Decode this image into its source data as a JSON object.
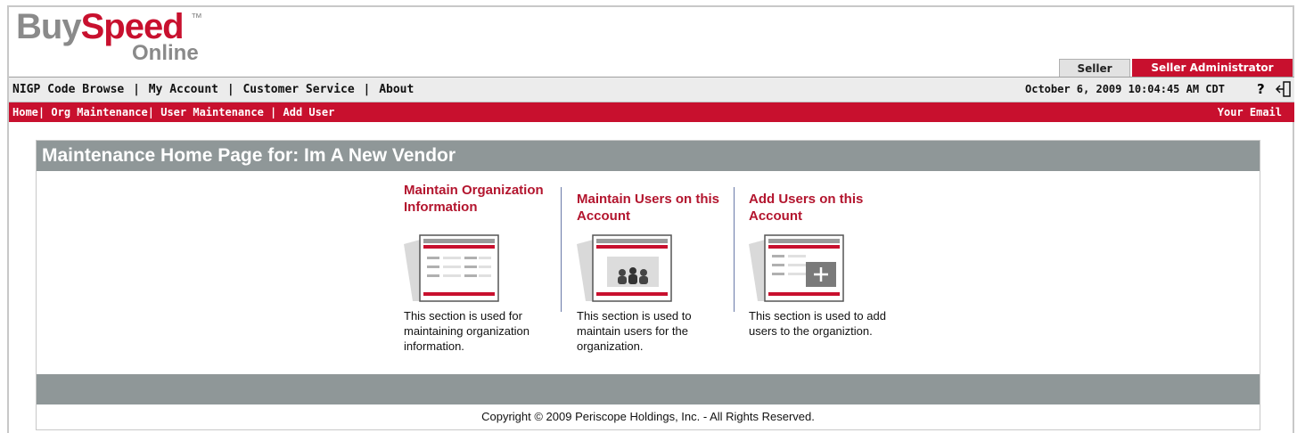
{
  "logo": {
    "part1": "Buy",
    "part2": "Speed",
    "tm": "™",
    "online": "Online"
  },
  "role_tabs": {
    "seller": "Seller",
    "seller_admin": "Seller Administrator"
  },
  "top_nav": {
    "items": [
      "NIGP Code Browse",
      "My Account",
      "Customer Service",
      "About"
    ],
    "separator": "|",
    "datetime": "October 6, 2009 10:04:45 AM CDT",
    "help": "?"
  },
  "sub_nav": {
    "items": [
      "Home",
      "Org Maintenance",
      "User Maintenance",
      "Add User"
    ],
    "separator": "|",
    "your_email": "Your Email"
  },
  "panel": {
    "title": "Maintenance Home Page for: Im A New Vendor",
    "items": [
      {
        "title": "Maintain Organization Information",
        "description": "This section is used for maintaining organization information.",
        "icon": "organization-form-icon"
      },
      {
        "title": "Maintain Users on this Account",
        "description": "This section is used to maintain users for the organization.",
        "icon": "users-group-icon"
      },
      {
        "title": "Add Users on this Account",
        "description": "This section is used to add users to the organiztion.",
        "icon": "add-user-icon"
      }
    ],
    "copyright": "Copyright © 2009 Periscope Holdings, Inc. - All Rights Reserved."
  },
  "colors": {
    "brand_red": "#c8102e",
    "header_gray": "#8f9798",
    "link_red": "#b3152e"
  }
}
